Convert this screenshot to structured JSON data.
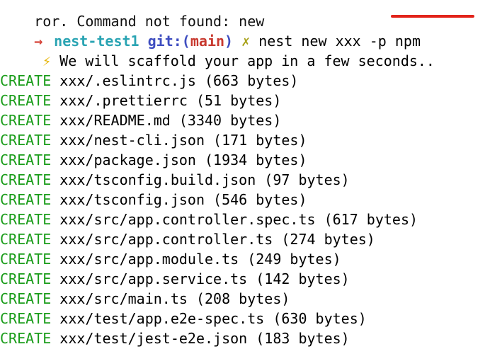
{
  "cut_line": "ror. Command not found: new",
  "prompt": {
    "arrow": "→",
    "dir": "nest-test1",
    "git_label": "git:(",
    "branch": "main",
    "git_close": ")",
    "dirty_mark": "✗",
    "command": "nest new xxx -p npm"
  },
  "info": {
    "icon": "⚡",
    "text": "We will scaffold your app in a few seconds.."
  },
  "files": [
    {
      "action": "CREATE",
      "detail": "xxx/.eslintrc.js (663 bytes)"
    },
    {
      "action": "CREATE",
      "detail": "xxx/.prettierrc (51 bytes)"
    },
    {
      "action": "CREATE",
      "detail": "xxx/README.md (3340 bytes)"
    },
    {
      "action": "CREATE",
      "detail": "xxx/nest-cli.json (171 bytes)"
    },
    {
      "action": "CREATE",
      "detail": "xxx/package.json (1934 bytes)"
    },
    {
      "action": "CREATE",
      "detail": "xxx/tsconfig.build.json (97 bytes)"
    },
    {
      "action": "CREATE",
      "detail": "xxx/tsconfig.json (546 bytes)"
    },
    {
      "action": "CREATE",
      "detail": "xxx/src/app.controller.spec.ts (617 bytes)"
    },
    {
      "action": "CREATE",
      "detail": "xxx/src/app.controller.ts (274 bytes)"
    },
    {
      "action": "CREATE",
      "detail": "xxx/src/app.module.ts (249 bytes)"
    },
    {
      "action": "CREATE",
      "detail": "xxx/src/app.service.ts (142 bytes)"
    },
    {
      "action": "CREATE",
      "detail": "xxx/src/main.ts (208 bytes)"
    },
    {
      "action": "CREATE",
      "detail": "xxx/test/app.e2e-spec.ts (630 bytes)"
    },
    {
      "action": "CREATE",
      "detail": "xxx/test/jest-e2e.json (183 bytes)"
    }
  ],
  "colors": {
    "create": "#1a9c1a",
    "dir": "#2aa4b3",
    "branch": "#c8392f",
    "annotation_underline": "#e2231a"
  }
}
